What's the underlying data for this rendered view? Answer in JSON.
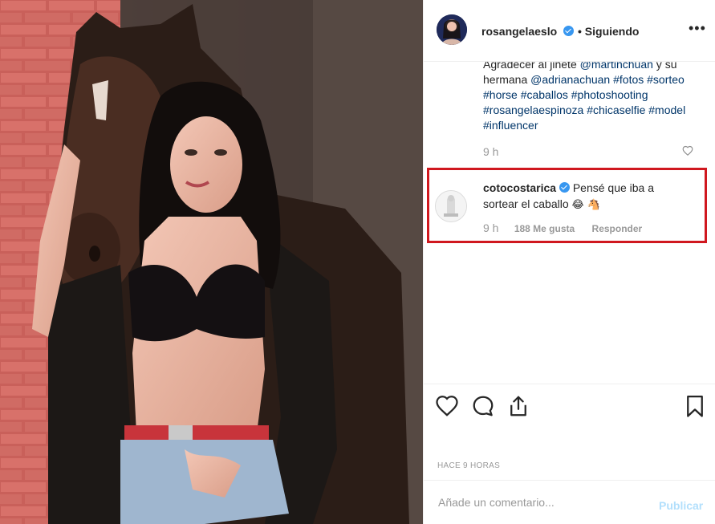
{
  "post": {
    "author": {
      "username": "rosangelaeslo",
      "verified": true,
      "follow_separator": "•",
      "follow_status": "Siguiendo"
    },
    "more_icon": "more-horizontal-icon",
    "caption": {
      "line1": "Agradecer al jinete",
      "mention1": "@martinchuan",
      "text_y": "y",
      "line2": "su hermana",
      "mention2": "@adrianachuan",
      "tags": [
        "#fotos",
        "#sorteo",
        "#horse",
        "#caballos",
        "#photoshooting",
        "#rosangelaespinoza",
        "#chicaselfie",
        "#model",
        "#influencer"
      ],
      "time": "9 h"
    },
    "comment": {
      "username": "cotocostarica",
      "verified": true,
      "text": "Pensé que iba a sortear el caballo",
      "emojis": [
        "😂",
        "🐴"
      ],
      "time": "9 h",
      "likes": "188 Me gusta",
      "reply_label": "Responder",
      "like_icon": "heart-outline-icon",
      "highlight_color": "#d0181f"
    },
    "actions": {
      "like_icon": "heart-icon",
      "comment_icon": "comment-icon",
      "share_icon": "share-icon",
      "save_icon": "bookmark-icon"
    },
    "timestamp": "HACE 9 HORAS",
    "add_comment": {
      "placeholder": "Añade un comentario...",
      "publish_label": "Publicar"
    }
  },
  "colors": {
    "link": "#003569",
    "verified": "#3897f0",
    "muted": "#999999",
    "publish_disabled": "#b2dffc"
  }
}
